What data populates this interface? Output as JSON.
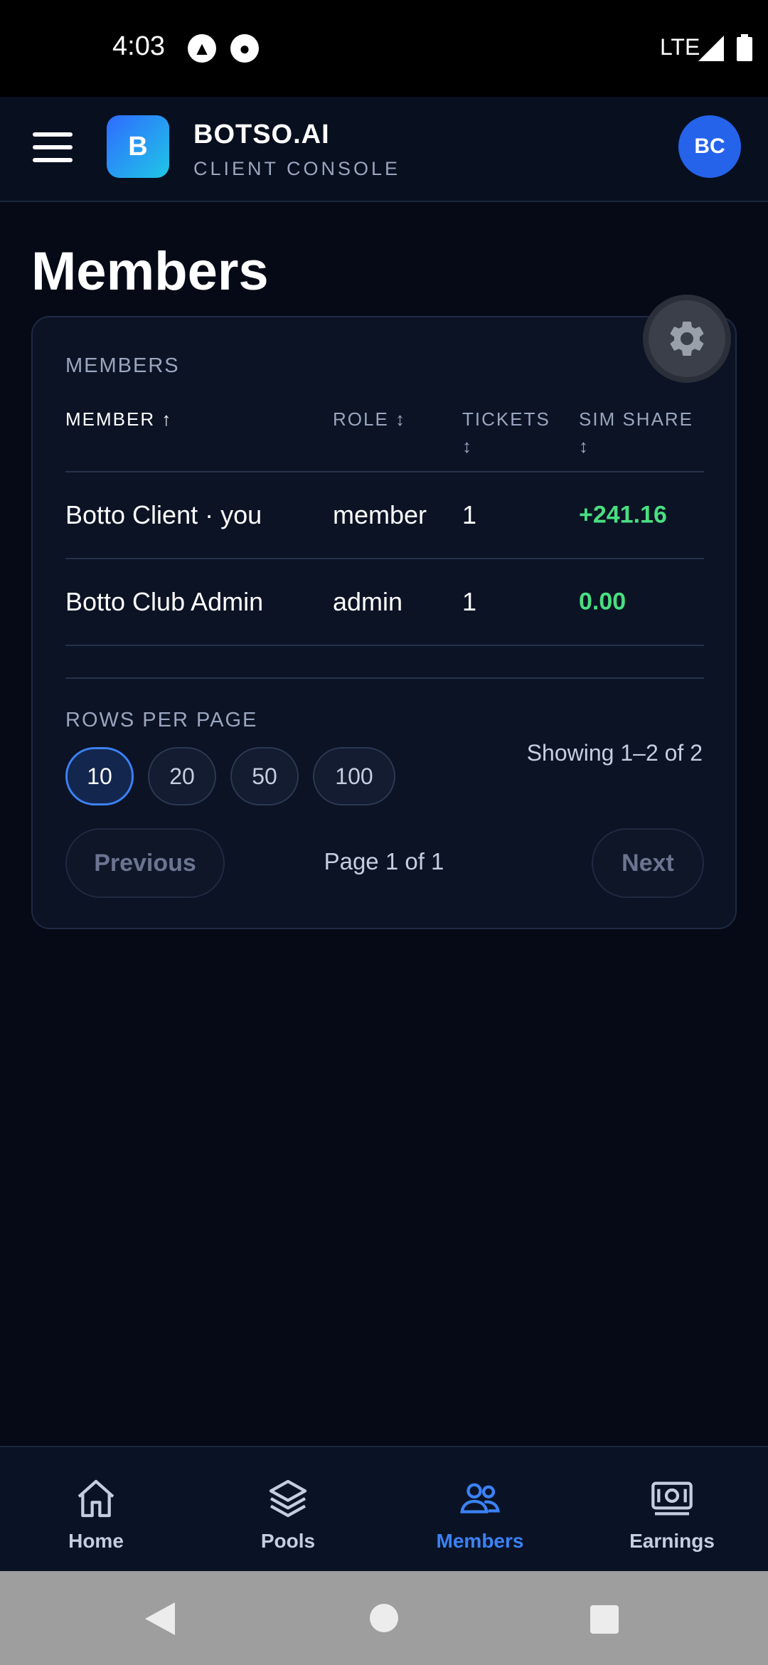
{
  "status_bar": {
    "time": "4:03",
    "network": "LTE"
  },
  "header": {
    "brand_initial": "B",
    "brand_name": "BOTSO.AI",
    "brand_subtitle": "CLIENT CONSOLE",
    "avatar_initials": "BC"
  },
  "page": {
    "title": "Members"
  },
  "members_card": {
    "label": "MEMBERS",
    "columns": [
      {
        "label": "MEMBER ↑",
        "sort": "asc"
      },
      {
        "label": "ROLE ↕",
        "sort": "none"
      },
      {
        "label": "TICKETS ↕",
        "sort": "none"
      },
      {
        "label": "SIM SHARE ↕",
        "sort": "none"
      }
    ],
    "rows": [
      {
        "member": "Botto Client · you",
        "role": "member",
        "tickets": "1",
        "sim_share": "+241.16"
      },
      {
        "member": "Botto Club Admin",
        "role": "admin",
        "tickets": "1",
        "sim_share": "0.00"
      }
    ],
    "rows_per_page_label": "ROWS PER PAGE",
    "page_sizes": [
      "10",
      "20",
      "50",
      "100"
    ],
    "selected_page_size": "10",
    "showing_text": "Showing 1–2 of 2",
    "previous_label": "Previous",
    "page_indicator": "Page 1 of 1",
    "next_label": "Next"
  },
  "bottom_nav": [
    {
      "label": "Home",
      "icon": "home-icon",
      "active": false
    },
    {
      "label": "Pools",
      "icon": "layers-icon",
      "active": false
    },
    {
      "label": "Members",
      "icon": "users-icon",
      "active": true
    },
    {
      "label": "Earnings",
      "icon": "banknote-icon",
      "active": false
    }
  ],
  "colors": {
    "accent": "#3b82f6",
    "positive": "#4ade80",
    "background": "#050a16",
    "card": "#0b1325"
  }
}
